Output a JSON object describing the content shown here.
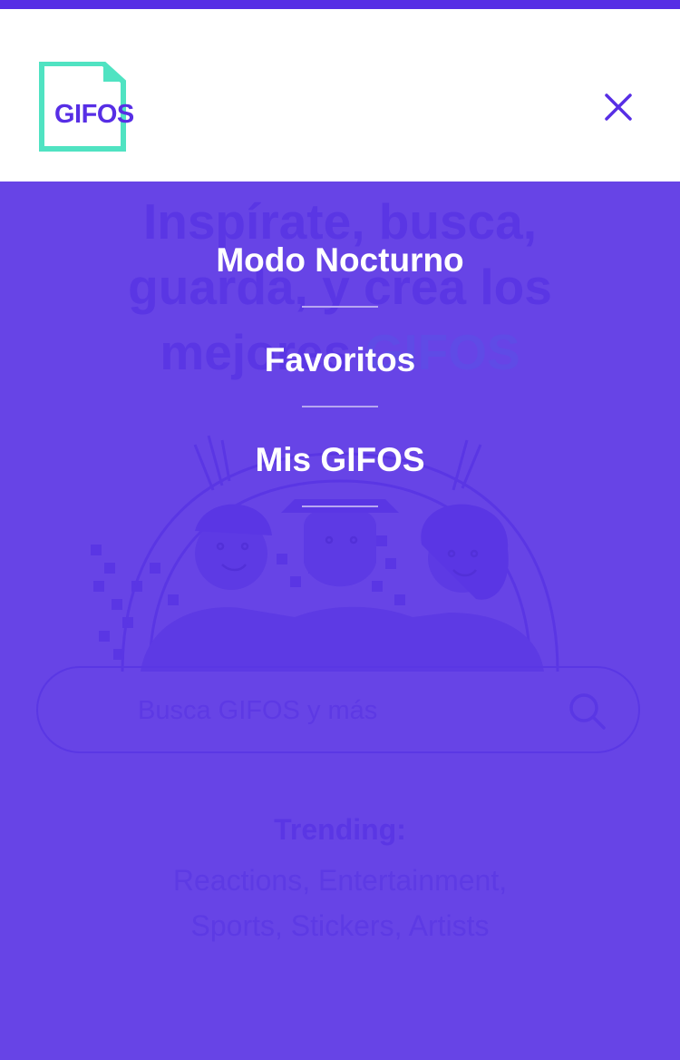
{
  "header": {
    "logo_text": "GIFOS",
    "close_icon": "close-icon"
  },
  "hero": {
    "title_line1": "Inspírate, busca,",
    "title_line2": "guarda, y crea los",
    "title_line3_a": "mejores ",
    "title_line3_b": "GIFOS"
  },
  "search": {
    "placeholder": "Busca GIFOS y más",
    "icon": "search-icon"
  },
  "trending": {
    "title": "Trending:",
    "items": "Reactions, Entertainment, Sports, Stickers, Artists"
  },
  "menu": {
    "items": [
      {
        "label": "Modo Nocturno"
      },
      {
        "label": "Favoritos"
      },
      {
        "label": "Mis GIFOS"
      }
    ]
  },
  "colors": {
    "overlay": "#6744e6",
    "primary": "#572ee5",
    "logo_accent": "#50e3c2",
    "white": "#ffffff"
  }
}
